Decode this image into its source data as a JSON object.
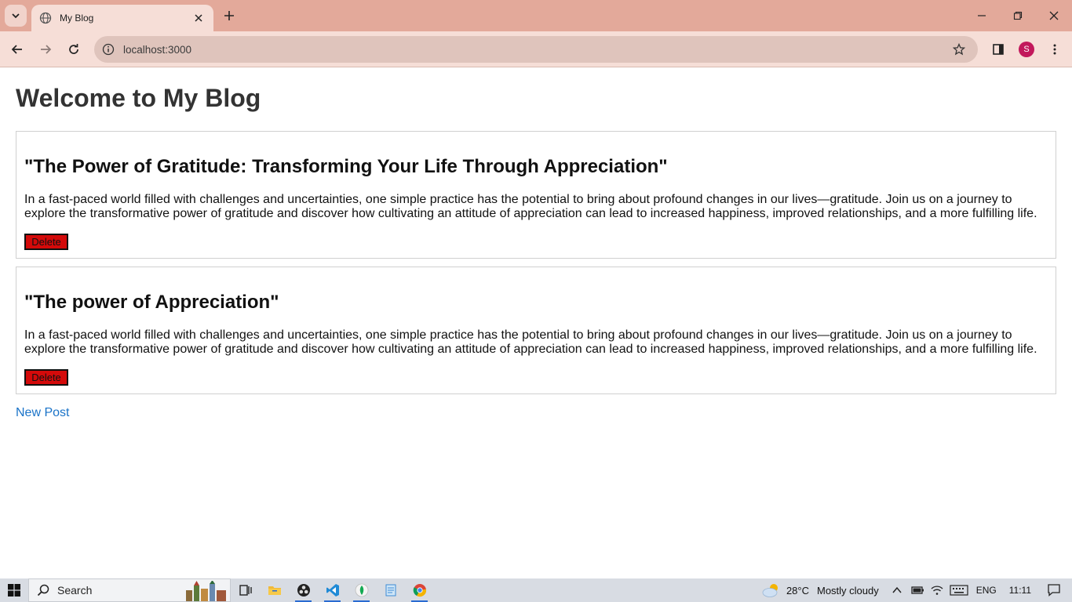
{
  "browser": {
    "tab_title": "My Blog",
    "url": "localhost:3000",
    "profile_initial": "S"
  },
  "page": {
    "title": "Welcome to My Blog",
    "posts": [
      {
        "title": "\"The Power of Gratitude: Transforming Your Life Through Appreciation\"",
        "body": "In a fast-paced world filled with challenges and uncertainties, one simple practice has the potential to bring about profound changes in our lives—gratitude. Join us on a journey to explore the transformative power of gratitude and discover how cultivating an attitude of appreciation can lead to increased happiness, improved relationships, and a more fulfilling life.",
        "delete_label": "Delete"
      },
      {
        "title": "\"The power of Appreciation\"",
        "body": "In a fast-paced world filled with challenges and uncertainties, one simple practice has the potential to bring about profound changes in our lives—gratitude. Join us on a journey to explore the transformative power of gratitude and discover how cultivating an attitude of appreciation can lead to increased happiness, improved relationships, and a more fulfilling life.",
        "delete_label": "Delete"
      }
    ],
    "new_post_label": "New Post"
  },
  "taskbar": {
    "search_label": "Search",
    "weather_temp": "28°C",
    "weather_desc": "Mostly cloudy",
    "language": "ENG",
    "time": "11:11"
  },
  "colors": {
    "tabbar": "#e3a99a",
    "toolbar": "#f6ded7",
    "delete_button": "#d40a0a",
    "link": "#1a73c8"
  }
}
